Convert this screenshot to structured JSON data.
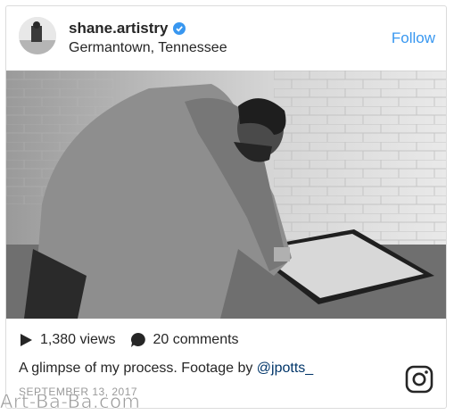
{
  "post": {
    "username": "shane.artistry",
    "location": "Germantown, Tennessee",
    "follow_label": "Follow",
    "views": "1,380 views",
    "comments": "20 comments",
    "caption_text": "A glimpse of my process. Footage by ",
    "caption_mention": "@jpotts_",
    "date": "SEPTEMBER 13, 2017"
  },
  "icons": {
    "verified": "verified-badge-icon",
    "play": "play-icon",
    "comment": "comment-bubble-icon",
    "instagram": "instagram-logo-icon"
  },
  "colors": {
    "link": "#3897f0",
    "mention": "#003569",
    "text": "#262626",
    "muted": "#999999"
  },
  "watermark": "Art-Ba-Ba.com"
}
